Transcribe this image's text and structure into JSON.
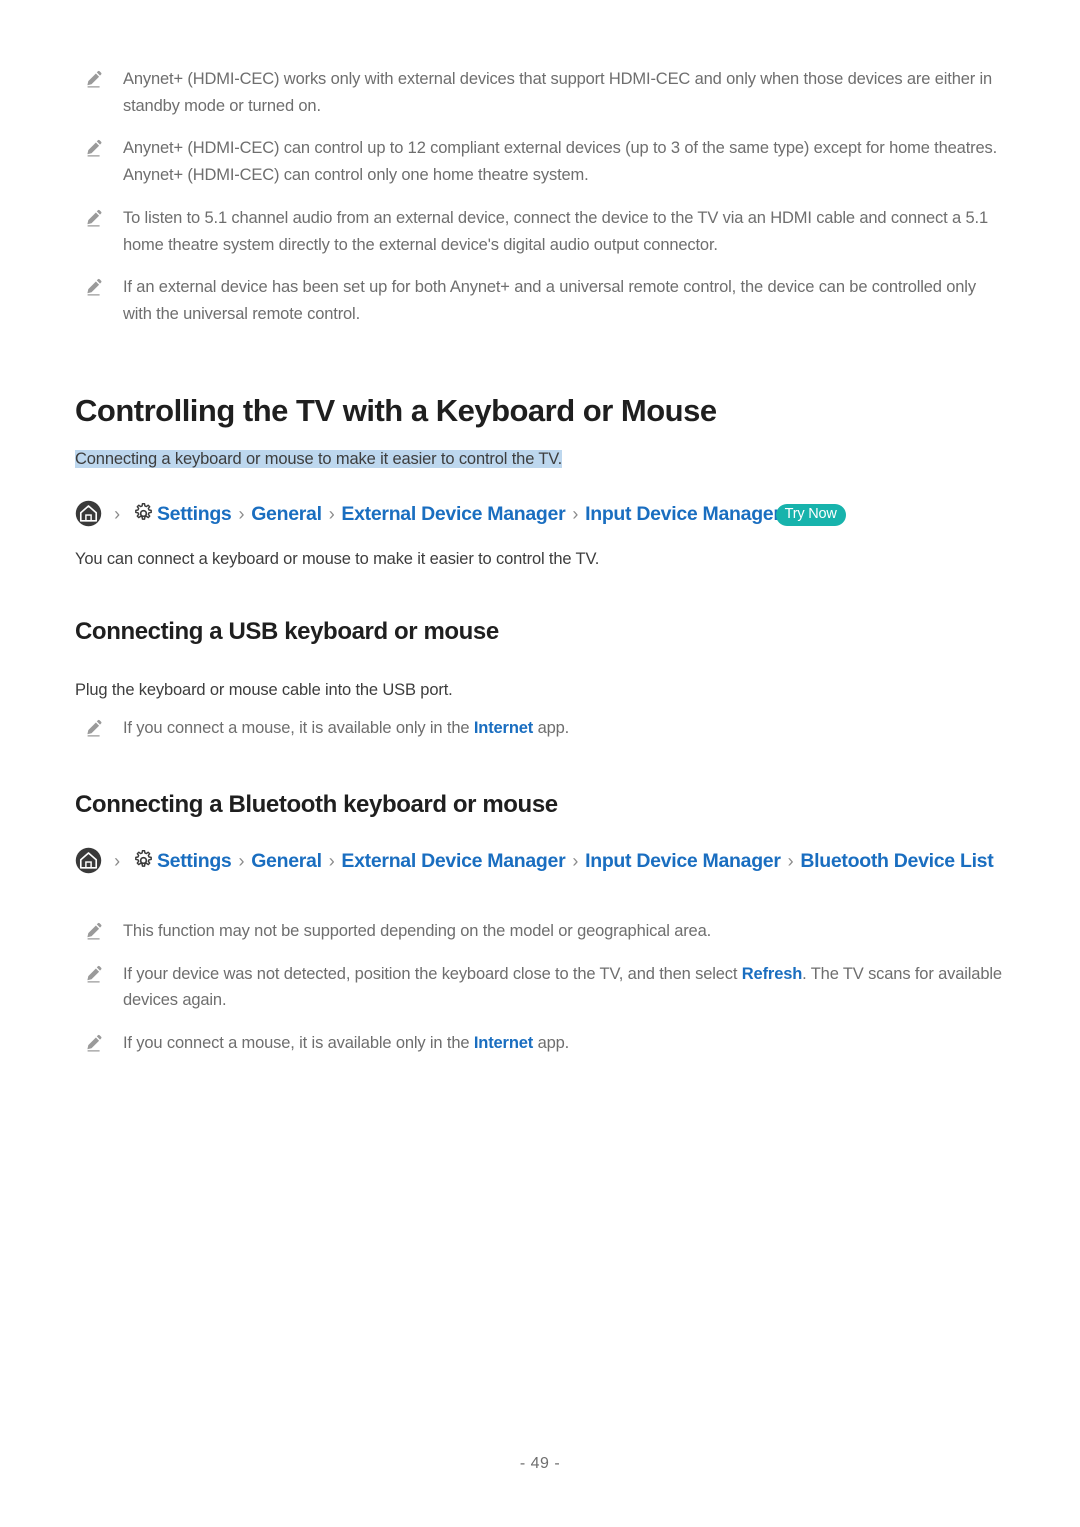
{
  "document": {
    "page_number": "- 49 -"
  },
  "notes_top": [
    "Anynet+ (HDMI-CEC) works only with external devices that support HDMI-CEC and only when those devices are either in standby mode or turned on.",
    "Anynet+ (HDMI-CEC) can control up to 12 compliant external devices (up to 3 of the same type) except for home theatres. Anynet+ (HDMI-CEC) can control only one home theatre system.",
    "To listen to 5.1 channel audio from an external device, connect the device to the TV via an HDMI cable and connect a 5.1 home theatre system directly to the external device's digital audio output connector.",
    "If an external device has been set up for both Anynet+ and a universal remote control, the device can be controlled only with the universal remote control."
  ],
  "section": {
    "title": "Controlling the TV with a Keyboard or Mouse",
    "summary": "Connecting a keyboard or mouse to make it easier to control the TV.",
    "intro": "You can connect a keyboard or mouse to make it easier to control the TV."
  },
  "breadcrumb_1": {
    "home_icon": "home-icon",
    "gear_icon": "gear-icon",
    "separator": "›",
    "crumbs": [
      "Settings",
      "General",
      "External Device Manager",
      "Input Device Manager"
    ],
    "badge": "Try Now"
  },
  "usb_section": {
    "heading": "Connecting a USB keyboard or mouse",
    "body": "Plug the keyboard or mouse cable into the USB port.",
    "notes": [
      {
        "before": "If you connect a mouse, it is available only in the ",
        "link": "Internet",
        "after": " app."
      }
    ]
  },
  "bluetooth_section": {
    "heading": "Connecting a Bluetooth keyboard or mouse",
    "notes": [
      {
        "before": "This function may not be supported depending on the model or geographical area.",
        "link": "",
        "after": ""
      },
      {
        "before": "If your device was not detected, position the keyboard close to the TV, and then select ",
        "link": "Refresh",
        "after": ". The TV scans for available devices again."
      },
      {
        "before": "If you connect a mouse, it is available only in the ",
        "link": "Internet",
        "after": " app."
      }
    ]
  },
  "breadcrumb_2": {
    "home_icon": "home-icon",
    "gear_icon": "gear-icon",
    "separator": "›",
    "crumbs": [
      "Settings",
      "General",
      "External Device Manager",
      "Input Device Manager",
      "Bluetooth Device List"
    ]
  },
  "colors": {
    "link": "#1a6ec0",
    "highlight": "#bdd7ee",
    "badge": "#17b3ac",
    "note_text": "#6e6e6e",
    "body_text": "#3d3d3d",
    "heading": "#1f1f1f"
  }
}
